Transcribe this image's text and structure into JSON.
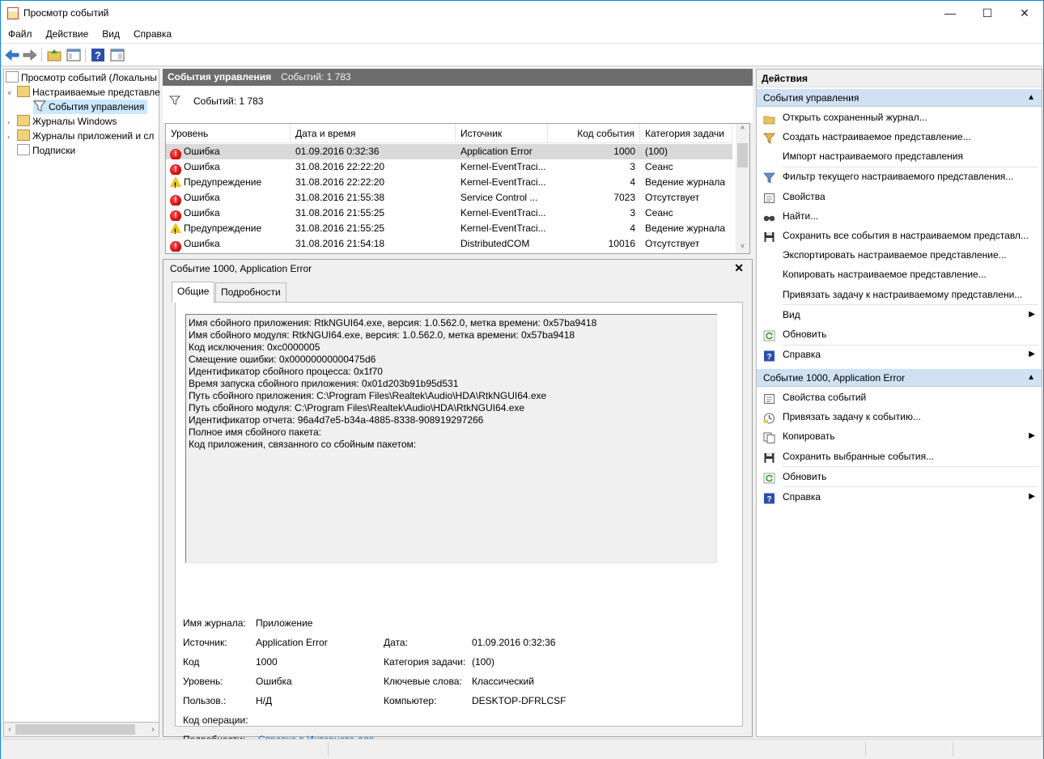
{
  "window": {
    "title": "Просмотр событий",
    "controls": {
      "minimize": "—",
      "maximize": "☐",
      "close": "✕"
    }
  },
  "menu": [
    "Файл",
    "Действие",
    "Вид",
    "Справка"
  ],
  "toolbar": [
    "back-arrow-icon",
    "forward-arrow-icon",
    "folder-up-icon",
    "console-tree-icon",
    "help-icon",
    "pane-icon"
  ],
  "tree": {
    "items": [
      {
        "label": "Просмотр событий (Локальны"
      },
      {
        "label": "Настраиваемые представле"
      },
      {
        "label": "События управления"
      },
      {
        "label": "Журналы Windows"
      },
      {
        "label": "Журналы приложений и сл"
      },
      {
        "label": "Подписки"
      }
    ],
    "expand": "˅",
    "collapsed": "›",
    "scroll_left": "‹",
    "scroll_right": "›"
  },
  "center": {
    "header_title": "События управления",
    "header_count": "Событий: 1 783",
    "filter_text": "Событий: 1 783",
    "columns": [
      "Уровень",
      "Дата и время",
      "Источник",
      "Код события",
      "Категория задачи"
    ],
    "rows": [
      {
        "level": "Ошибка",
        "type": "error",
        "date": "01.09.2016 0:32:36",
        "source": "Application Error",
        "code": "1000",
        "category": "(100)"
      },
      {
        "level": "Ошибка",
        "type": "error",
        "date": "31.08.2016 22:22:20",
        "source": "Kernel-EventTraci...",
        "code": "3",
        "category": "Сеанс"
      },
      {
        "level": "Предупреждение",
        "type": "warn",
        "date": "31.08.2016 22:22:20",
        "source": "Kernel-EventTraci...",
        "code": "4",
        "category": "Ведение журнала"
      },
      {
        "level": "Ошибка",
        "type": "error",
        "date": "31.08.2016 21:55:38",
        "source": "Service Control ...",
        "code": "7023",
        "category": "Отсутствует"
      },
      {
        "level": "Ошибка",
        "type": "error",
        "date": "31.08.2016 21:55:25",
        "source": "Kernel-EventTraci...",
        "code": "3",
        "category": "Сеанс"
      },
      {
        "level": "Предупреждение",
        "type": "warn",
        "date": "31.08.2016 21:55:25",
        "source": "Kernel-EventTraci...",
        "code": "4",
        "category": "Ведение журнала"
      },
      {
        "level": "Ошибка",
        "type": "error",
        "date": "31.08.2016 21:54:18",
        "source": "DistributedCOM",
        "code": "10016",
        "category": "Отсутствует"
      }
    ],
    "scroll_up": "˄",
    "scroll_down": "˅"
  },
  "detail": {
    "title": "Событие 1000, Application Error",
    "close": "✕",
    "tabs": [
      "Общие",
      "Подробности"
    ],
    "description": [
      "Имя сбойного приложения: RtkNGUI64.exe, версия: 1.0.562.0, метка времени: 0x57ba9418",
      "Имя сбойного модуля: RtkNGUI64.exe, версия: 1.0.562.0, метка времени: 0x57ba9418",
      "Код исключения: 0xc0000005",
      "Смещение ошибки: 0x00000000000475d6",
      "Идентификатор сбойного процесса: 0x1f70",
      "Время запуска сбойного приложения: 0x01d203b91b95d531",
      "Путь сбойного приложения: C:\\Program Files\\Realtek\\Audio\\HDA\\RtkNGUI64.exe",
      "Путь сбойного модуля: C:\\Program Files\\Realtek\\Audio\\HDA\\RtkNGUI64.exe",
      "Идентификатор отчета: 96a4d7e5-b34a-4885-8338-908919297266",
      "Полное имя сбойного пакета:",
      "Код приложения, связанного со сбойным пакетом:"
    ],
    "props": {
      "log_label": "Имя журнала:",
      "log_value": "Приложение",
      "source_label": "Источник:",
      "source_value": "Application Error",
      "date_label": "Дата:",
      "date_value": "01.09.2016 0:32:36",
      "code_label": "Код",
      "code_value": "1000",
      "category_label": "Категория задачи:",
      "category_value": "(100)",
      "level_label": "Уровень:",
      "level_value": "Ошибка",
      "keywords_label": "Ключевые слова:",
      "keywords_value": "Классический",
      "user_label": "Пользов.:",
      "user_value": "Н/Д",
      "computer_label": "Компьютер:",
      "computer_value": "DESKTOP-DFRLCSF",
      "opcode_label": "Код операции:",
      "details_label": "Подробности:",
      "details_link": "Справка в Интернете для"
    }
  },
  "actions": {
    "head": "Действия",
    "section1": {
      "title": "События управления",
      "items": [
        "Открыть сохраненный журнал...",
        "Создать настраиваемое представление...",
        "Импорт настраиваемого представления",
        "Фильтр текущего настраиваемого представления...",
        "Свойства",
        "Найти...",
        "Сохранить все события в настраиваемом представл...",
        "Экспортировать настраиваемое представление...",
        "Копировать настраиваемое представление...",
        "Привязать задачу к настраиваемому представлени...",
        "Вид",
        "Обновить",
        "Справка"
      ]
    },
    "section2": {
      "title": "Событие 1000, Application Error",
      "items": [
        "Свойства событий",
        "Привязать задачу к событию...",
        "Копировать",
        "Сохранить выбранные события...",
        "Обновить",
        "Справка"
      ]
    },
    "collapse": "▲",
    "submenu": "▶"
  },
  "colors": {
    "accent": "#1883d7",
    "section_head": "#cfe1f2",
    "center_header": "#6d6d6d",
    "link": "#0066cc",
    "error": "#cc0000",
    "warning": "#f3c11b"
  }
}
